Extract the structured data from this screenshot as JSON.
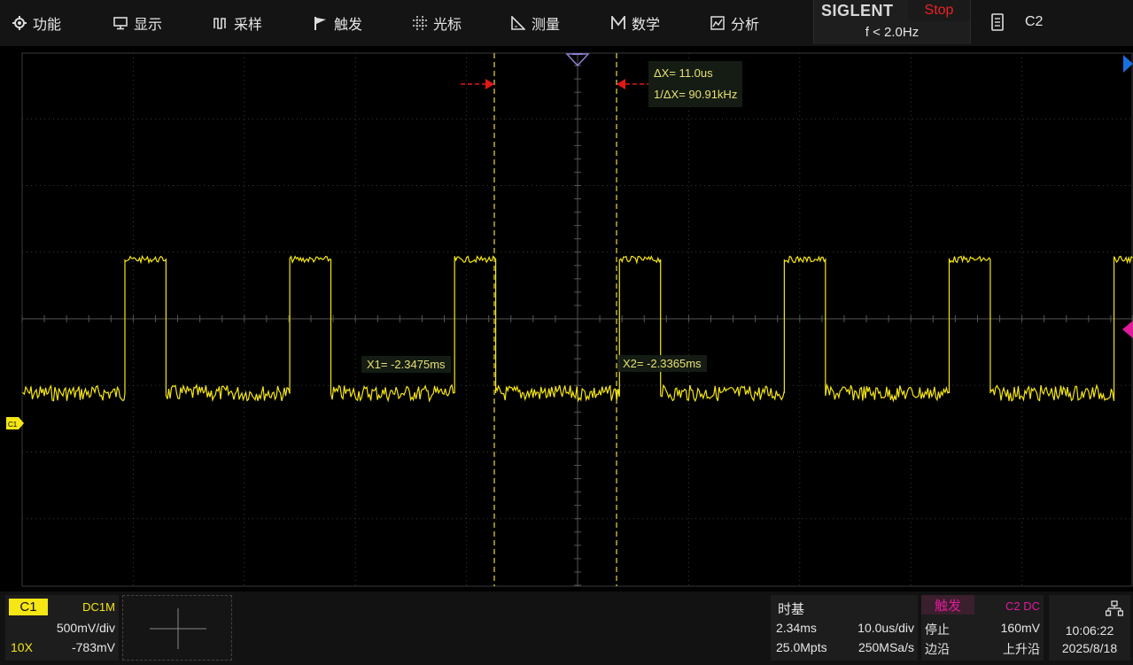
{
  "menu": [
    {
      "label": "功能",
      "icon": "gear-icon"
    },
    {
      "label": "显示",
      "icon": "monitor-icon"
    },
    {
      "label": "采样",
      "icon": "acquire-icon"
    },
    {
      "label": "触发",
      "icon": "flag-icon"
    },
    {
      "label": "光标",
      "icon": "cursor-icon"
    },
    {
      "label": "测量",
      "icon": "ruler-icon"
    },
    {
      "label": "数学",
      "icon": "math-icon"
    },
    {
      "label": "分析",
      "icon": "analysis-icon"
    }
  ],
  "brand": {
    "name": "SIGLENT",
    "run_state": "Stop",
    "frequency": "f < 2.0Hz"
  },
  "active_channel": "C2",
  "cursors": {
    "delta_x": "ΔX= 11.0us",
    "inv_delta_x": "1/ΔX= 90.91kHz",
    "x1": "X1= -2.3475ms",
    "x2": "X2= -2.3365ms"
  },
  "channel1": {
    "name": "C1",
    "coupling": "DC1M",
    "scale": "500mV/div",
    "probe": "10X",
    "offset": "-783mV",
    "marker": "C1"
  },
  "timebase": {
    "title": "时基",
    "delay": "2.34ms",
    "scale": "10.0us/div",
    "memory": "25.0Mpts",
    "sample_rate": "250MSa/s"
  },
  "trigger": {
    "title": "触发",
    "source": "C2 DC",
    "state": "停止",
    "level": "160mV",
    "type": "边沿",
    "slope": "上升沿"
  },
  "clock": {
    "time": "10:06:22",
    "date": "2025/8/18"
  },
  "colors": {
    "ch1": "#f5e614",
    "grid": "#3a3a3a",
    "cursor": "#e8d84a",
    "marker_red": "#e01818",
    "marker_blue": "#1a6fe0",
    "marker_magenta": "#e01a9b"
  },
  "waveform": {
    "description_free": true,
    "high_level_div": 2.35,
    "low_level_div": 0.35,
    "period_us": 20.0,
    "high_duration_us": 4.9,
    "first_rise_div": 1.15
  }
}
